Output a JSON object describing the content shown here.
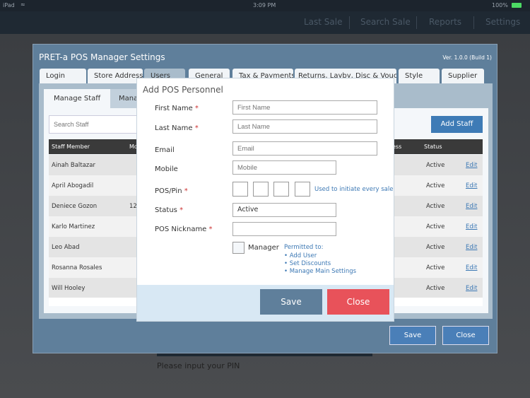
{
  "statusbar": {
    "device": "iPad",
    "time": "3:09 PM",
    "battery": "100%"
  },
  "nav": {
    "items": [
      "Last Sale",
      "Search Sale",
      "Reports",
      "Settings"
    ]
  },
  "panel": {
    "title": "PRET-a POS Manager Settings",
    "version": "Ver. 1.0.0 (Build 1)",
    "tabs": [
      "Login",
      "Store Address",
      "Users",
      "General",
      "Tax & Payments",
      "Returns, Layby, Disc & Vouchers",
      "Style",
      "Supplier"
    ],
    "subtabs": [
      "Manage Staff",
      "Mana"
    ],
    "search_placeholder": "Search Staff",
    "add_staff": "Add Staff",
    "columns": [
      "Staff Member",
      "Mo",
      "ess",
      "Status"
    ],
    "rows": [
      {
        "name": "Ainah Baltazar",
        "mobile": "",
        "status": "Active",
        "action": "Edit"
      },
      {
        "name": "April Abogadil",
        "mobile": "",
        "status": "Active",
        "action": "Edit"
      },
      {
        "name": "Deniece Gozon",
        "mobile": "12.",
        "status": "Active",
        "action": "Edit"
      },
      {
        "name": "Karlo Martinez",
        "mobile": "",
        "status": "Active",
        "action": "Edit"
      },
      {
        "name": "Leo Abad",
        "mobile": "",
        "status": "Active",
        "action": "Edit"
      },
      {
        "name": "Rosanna Rosales",
        "mobile": "",
        "status": "Active",
        "action": "Edit"
      },
      {
        "name": "Will Hooley",
        "mobile": "",
        "status": "Active",
        "action": "Edit"
      }
    ],
    "save": "Save",
    "close": "Close"
  },
  "dialog": {
    "title": "Add POS Personnel",
    "first_name": {
      "label": "First Name",
      "placeholder": "First Name"
    },
    "last_name": {
      "label": "Last Name",
      "placeholder": "Last Name"
    },
    "email": {
      "label": "Email",
      "placeholder": "Email"
    },
    "mobile": {
      "label": "Mobile",
      "placeholder": "Mobile"
    },
    "pin": {
      "label": "POS/Pin",
      "hint": "Used to initiate every sale"
    },
    "status": {
      "label": "Status",
      "value": "Active"
    },
    "nickname": {
      "label": "POS Nickname",
      "value": ""
    },
    "manager": {
      "label": "Manager",
      "checked": false,
      "permitted_title": "Permitted to:",
      "permissions": [
        "• Add User",
        "• Set Discounts",
        "• Manage Main Settings"
      ]
    },
    "required_mark": "*",
    "save": "Save",
    "close": "Close"
  },
  "background": {
    "pin_prompt": "Please input your PIN"
  },
  "colors": {
    "panel": "#5f7f9b",
    "accent": "#3e7bb6",
    "danger": "#e8525a"
  }
}
